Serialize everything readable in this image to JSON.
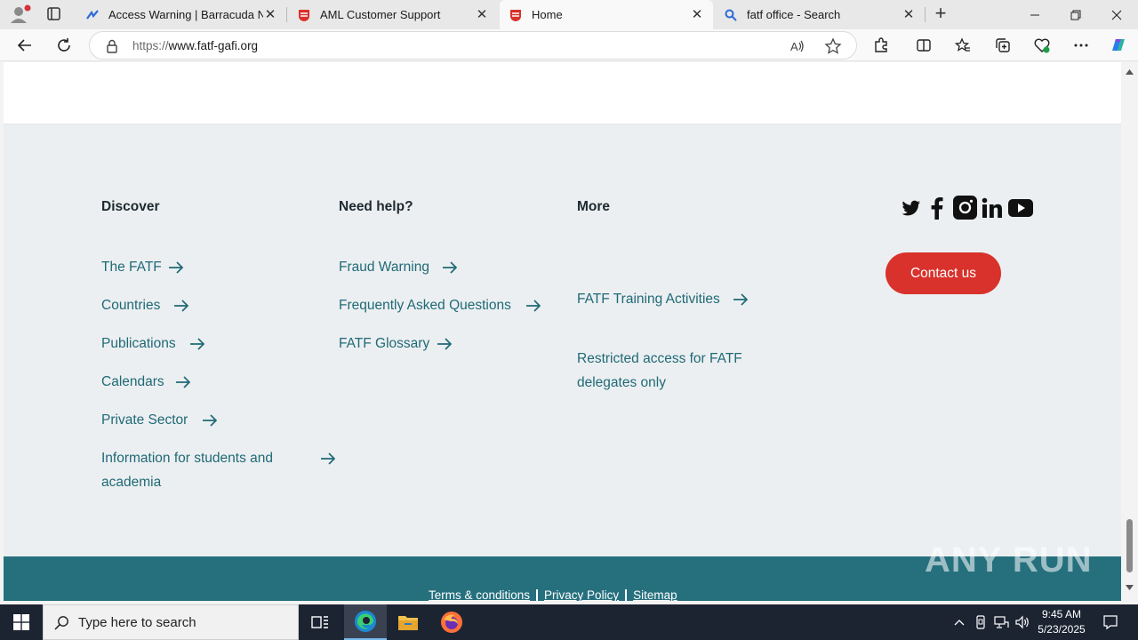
{
  "browser": {
    "tabs": [
      {
        "label": "Access Warning | Barracuda Netw",
        "active": false
      },
      {
        "label": "AML Customer Support",
        "active": false
      },
      {
        "label": "Home",
        "active": true
      },
      {
        "label": "fatf office - Search",
        "active": false
      }
    ],
    "new_tab_label": "+",
    "url_protocol": "https://",
    "url_host": "www.fatf-gafi.org"
  },
  "footer": {
    "columns": [
      {
        "heading": "Discover",
        "links": [
          "The FATF",
          "Countries",
          "Publications",
          "Calendars",
          "Private Sector",
          "Information for students and academia"
        ]
      },
      {
        "heading": "Need help?",
        "links": [
          "Fraud Warning",
          "Frequently Asked Questions",
          "FATF Glossary"
        ]
      },
      {
        "heading": "More",
        "links": [
          "FATF Training Activities",
          "Restricted access for FATF delegates only"
        ]
      }
    ],
    "contact_label": "Contact us",
    "social": [
      "twitter-icon",
      "facebook-icon",
      "instagram-icon",
      "linkedin-icon",
      "youtube-icon"
    ],
    "legal_links": [
      "Terms & conditions",
      "Privacy Policy",
      "Sitemap"
    ],
    "watermark": "ANY RUN"
  },
  "taskbar": {
    "search_placeholder": "Type here to search",
    "time": "9:45 AM",
    "date": "5/23/2025"
  },
  "colors": {
    "link": "#1f6a77",
    "accent_red": "#d9312b",
    "band": "#26707e"
  }
}
